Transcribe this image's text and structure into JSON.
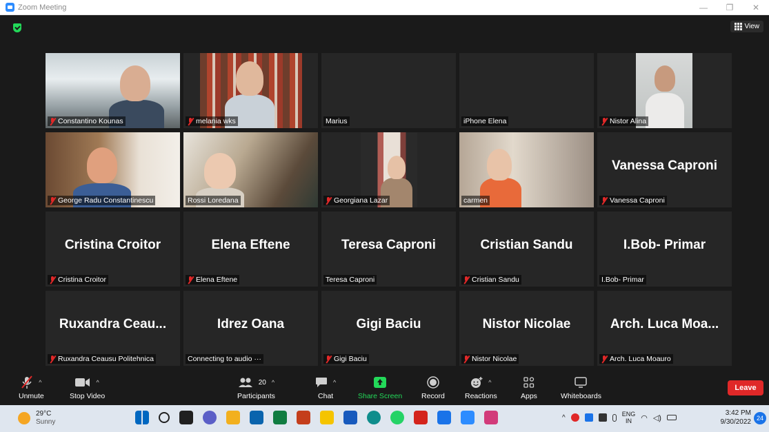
{
  "window": {
    "title": "Zoom Meeting",
    "controls": [
      "—",
      "❐",
      "✕"
    ]
  },
  "meeting": {
    "view_label": "View",
    "tiles": [
      {
        "display": "",
        "label": "Constantino Kounas",
        "muted": true,
        "video": "office"
      },
      {
        "display": "",
        "label": "melania wks",
        "muted": true,
        "video": "books"
      },
      {
        "display": "",
        "label": "Marius",
        "muted": false,
        "video": "none"
      },
      {
        "display": "",
        "label": "iPhone Elena",
        "muted": false,
        "video": "room"
      },
      {
        "display": "",
        "label": "Nistor Alina",
        "muted": true,
        "video": "wall"
      },
      {
        "display": "",
        "label": "George Radu Constantinescu",
        "muted": true,
        "video": "warm"
      },
      {
        "display": "",
        "label": "Rossi Loredana",
        "muted": false,
        "video": "kitchen",
        "active": true
      },
      {
        "display": "",
        "label": "Georgiana Lazar",
        "muted": true,
        "video": "curtain"
      },
      {
        "display": "",
        "label": "carmen",
        "muted": false,
        "video": "shelf"
      },
      {
        "display": "Vanessa Caproni",
        "label": "Vanessa Caproni",
        "muted": true,
        "video": "none"
      },
      {
        "display": "Cristina Croitor",
        "label": "Cristina Croitor",
        "muted": true,
        "video": "none"
      },
      {
        "display": "Elena Eftene",
        "label": "Elena Eftene",
        "muted": true,
        "video": "none"
      },
      {
        "display": "Teresa Caproni",
        "label": "Teresa Caproni",
        "muted": false,
        "video": "none"
      },
      {
        "display": "Cristian Sandu",
        "label": "Cristian Sandu",
        "muted": true,
        "video": "none"
      },
      {
        "display": "I.Bob- Primar",
        "label": "I.Bob- Primar",
        "muted": false,
        "video": "none"
      },
      {
        "display": "Ruxandra  Ceau...",
        "label": "Ruxandra Ceausu Politehnica",
        "muted": true,
        "video": "none"
      },
      {
        "display": "Idrez Oana",
        "label": "Connecting to audio ···",
        "muted": false,
        "video": "none"
      },
      {
        "display": "Gigi Baciu",
        "label": "Gigi Baciu",
        "muted": true,
        "video": "none"
      },
      {
        "display": "Nistor Nicolae",
        "label": "Nistor Nicolae",
        "muted": true,
        "video": "none"
      },
      {
        "display": "Arch. Luca Moa...",
        "label": "Arch. Luca Moauro",
        "muted": true,
        "video": "none"
      }
    ]
  },
  "toolbar": {
    "unmute": "Unmute",
    "stop_video": "Stop Video",
    "participants": "Participants",
    "participants_count": "20",
    "chat": "Chat",
    "share_screen": "Share Screen",
    "record": "Record",
    "reactions": "Reactions",
    "apps": "Apps",
    "whiteboards": "Whiteboards",
    "leave": "Leave",
    "colors": {
      "share": "#23d959",
      "leave": "#e02828",
      "active_speaker": "#d9f06a"
    }
  },
  "taskbar": {
    "temperature": "29°C",
    "condition": "Sunny",
    "lang_top": "ENG",
    "lang_bottom": "IN",
    "time": "3:42 PM",
    "date": "9/30/2022",
    "notification_count": "24",
    "apps": [
      "windows-start-icon",
      "search-icon",
      "task-view-icon",
      "teams-chat-icon",
      "file-explorer-icon",
      "outlook-icon",
      "excel-icon",
      "powerpoint-icon",
      "sticky-notes-icon",
      "word-icon",
      "edge-icon",
      "whatsapp-icon",
      "acrobat-icon",
      "teamviewer-icon",
      "zoom-icon",
      "snipping-tool-icon"
    ]
  }
}
